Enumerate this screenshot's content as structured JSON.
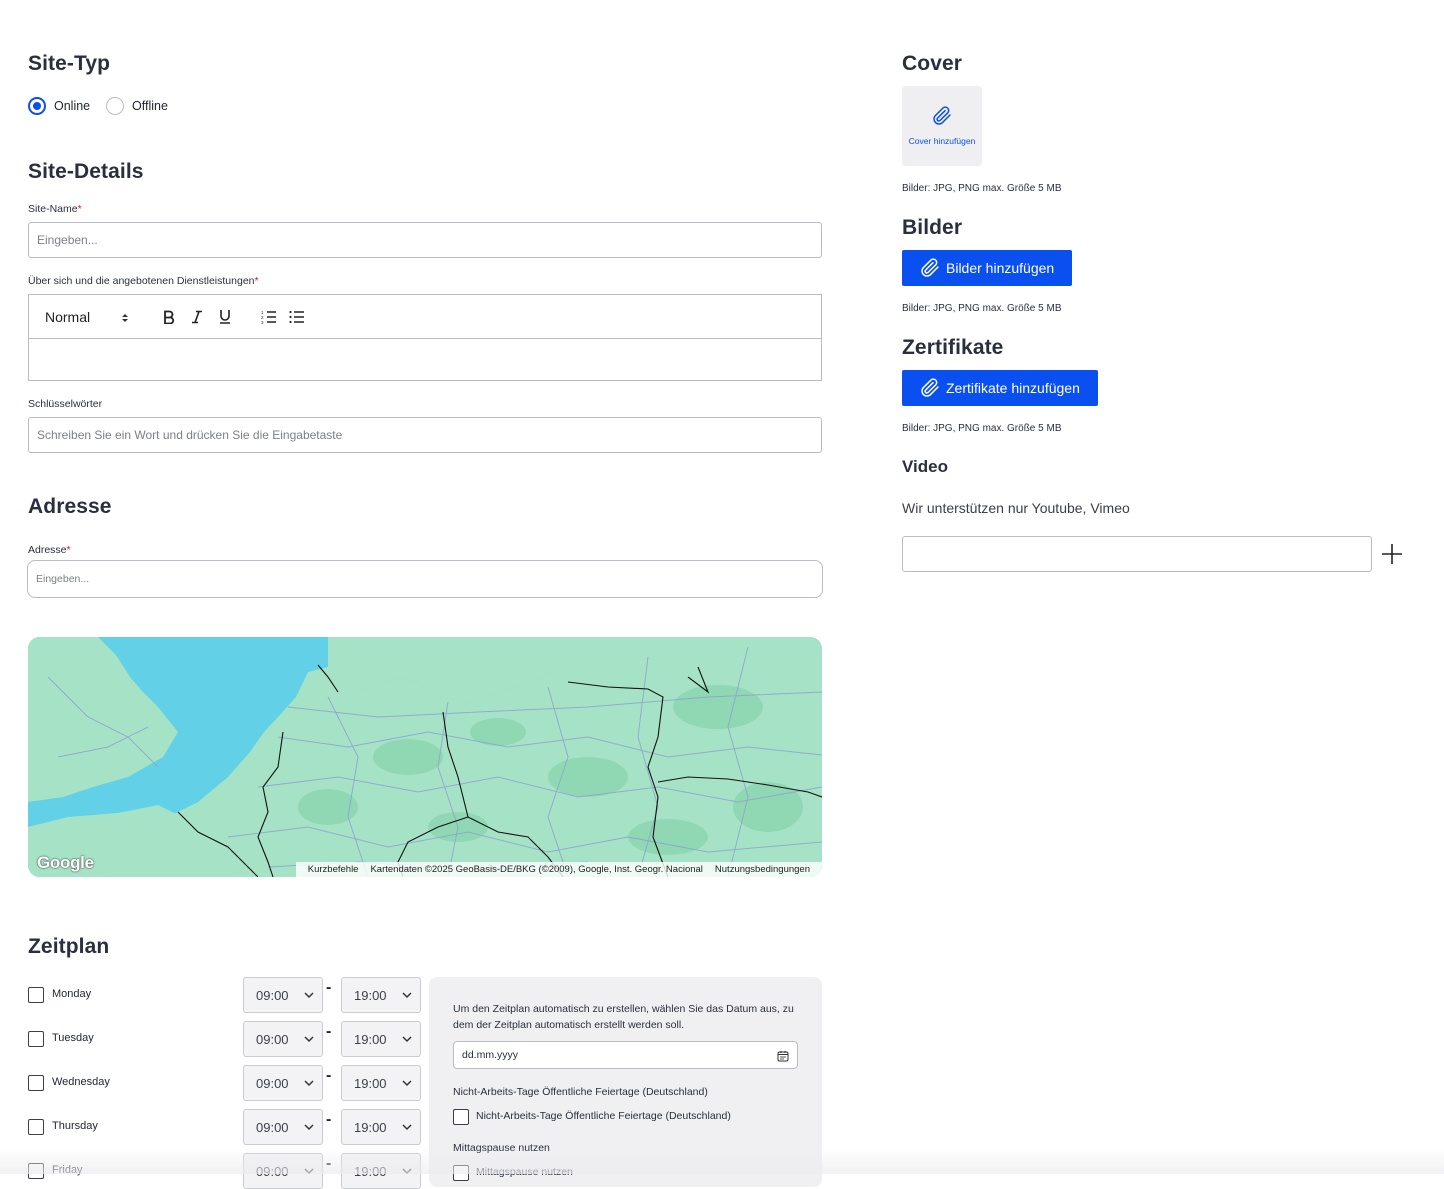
{
  "site_type": {
    "title": "Site-Typ",
    "options": [
      {
        "label": "Online",
        "selected": true
      },
      {
        "label": "Offline",
        "selected": false
      }
    ]
  },
  "site_details": {
    "title": "Site-Details",
    "name_label": "Site-Name",
    "name_placeholder": "Eingeben...",
    "about_label": "Über sich und die angebotenen Dienstleistungen",
    "editor": {
      "style_select": "Normal",
      "tools": [
        "bold-icon",
        "italic-icon",
        "underline-icon",
        "ordered-list-icon",
        "bullet-list-icon"
      ]
    },
    "keywords_label": "Schlüsselwörter",
    "keywords_placeholder": "Schreiben Sie ein Wort und drücken Sie die Eingabetaste"
  },
  "address": {
    "title": "Adresse",
    "label": "Adresse",
    "placeholder": "Eingeben...",
    "map": {
      "logo": "Google",
      "shortcuts": "Kurzbefehle",
      "attribution": "Kartendaten ©2025 GeoBasis-DE/BKG (©2009), Google, Inst. Geogr. Nacional",
      "terms": "Nutzungsbedingungen"
    }
  },
  "schedule": {
    "title": "Zeitplan",
    "days": [
      {
        "day": "Monday",
        "from": "09:00",
        "to": "19:00",
        "checked": false
      },
      {
        "day": "Tuesday",
        "from": "09:00",
        "to": "19:00",
        "checked": false
      },
      {
        "day": "Wednesday",
        "from": "09:00",
        "to": "19:00",
        "checked": false
      },
      {
        "day": "Thursday",
        "from": "09:00",
        "to": "19:00",
        "checked": false
      },
      {
        "day": "Friday",
        "from": "09:00",
        "to": "19:00",
        "checked": false
      }
    ],
    "separator": "-",
    "auto_text": "Um den Zeitplan automatisch zu erstellen, wählen Sie das Datum aus, zu dem der Zeitplan automatisch erstellt werden soll.",
    "date_placeholder": "dd.mm.yyyy",
    "holidays_title": "Nicht-Arbeits-Tage Öffentliche Feiertage (Deutschland)",
    "holidays_checkbox": "Nicht-Arbeits-Tage Öffentliche Feiertage (Deutschland)",
    "lunch_title": "Mittagspause nutzen",
    "lunch_checkbox": "Mittagspause nutzen"
  },
  "cover": {
    "title": "Cover",
    "add_label": "Cover hinzufügen",
    "hint": "Bilder: JPG, PNG max. Größe 5 MB"
  },
  "images": {
    "title": "Bilder",
    "button": "Bilder hinzufügen",
    "hint": "Bilder: JPG, PNG max. Größe 5 MB"
  },
  "certificates": {
    "title": "Zertifikate",
    "button": "Zertifikate hinzufügen",
    "hint": "Bilder: JPG, PNG max. Größe 5 MB"
  },
  "video": {
    "title": "Video",
    "subtitle": "Wir unterstützen nur Youtube, Vimeo",
    "input_value": ""
  },
  "colors": {
    "accent": "#0a4ff0",
    "required": "#e0112b",
    "water": "#62d0e6",
    "land": "#a6e3c6"
  }
}
